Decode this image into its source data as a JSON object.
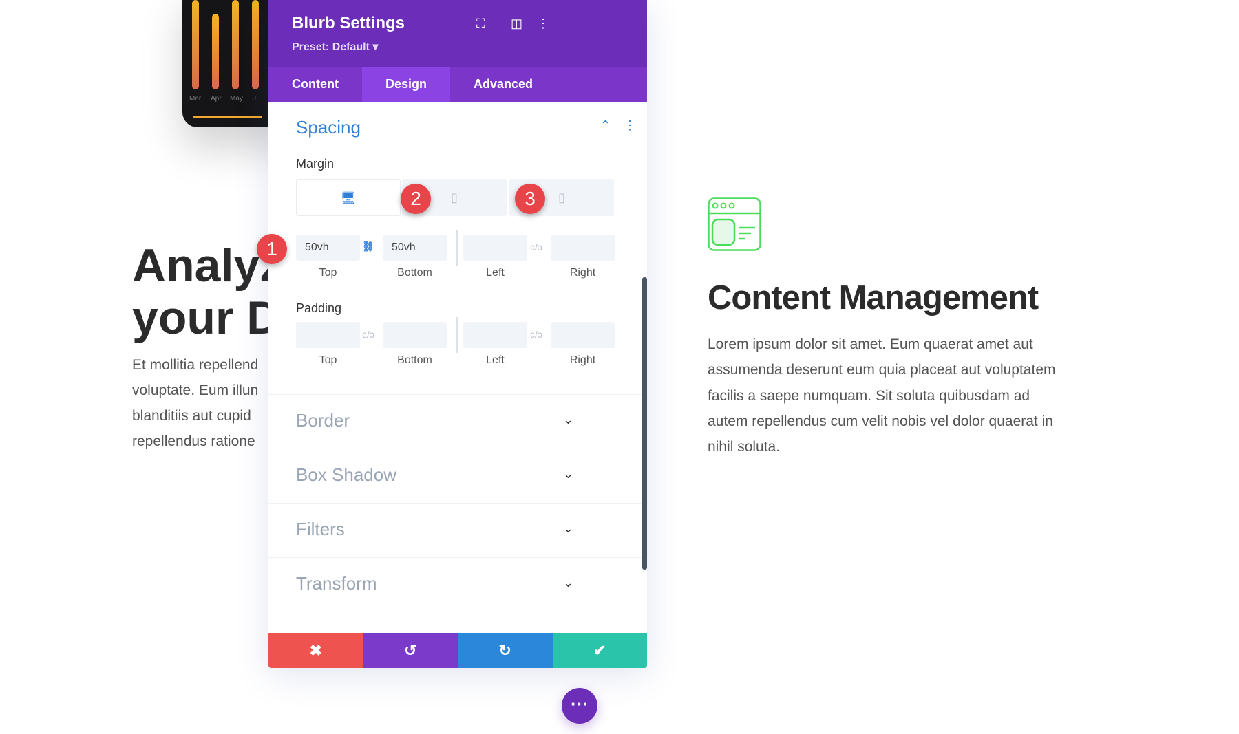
{
  "background": {
    "chart_months": [
      "Mar",
      "Apr",
      "May",
      "J"
    ],
    "left_heading": [
      "Analyz",
      "your D"
    ],
    "left_text": [
      "Et mollitia repellend",
      "voluptate. Eum illun",
      "blanditiis aut cupid",
      "repellendus ratione"
    ],
    "blurb": {
      "icon": "browser-window-icon",
      "icon_color": "#4cdc5c",
      "title": "Content Management",
      "text": "Lorem ipsum dolor sit amet. Eum quaerat amet aut assumenda deserunt eum quia placeat aut voluptatem facilis a saepe numquam. Sit soluta quibusdam ad autem repellendus cum velit nobis vel dolor quaerat in nihil soluta."
    }
  },
  "panel": {
    "title": "Blurb Settings",
    "preset": "Preset: Default ▾",
    "tabs": [
      {
        "label": "Content"
      },
      {
        "label": "Design"
      },
      {
        "label": "Advanced"
      }
    ],
    "active_tab": "Design",
    "spacing": {
      "title": "Spacing",
      "margin_label": "Margin",
      "padding_label": "Padding",
      "margin": {
        "top": "50vh",
        "bottom": "50vh",
        "left": "",
        "right": ""
      },
      "captions": {
        "top": "Top",
        "bottom": "Bottom",
        "left": "Left",
        "right": "Right"
      }
    },
    "sections": [
      "Border",
      "Box Shadow",
      "Filters",
      "Transform"
    ],
    "colors": {
      "header": "#6c2eb9",
      "cancel": "#ef5350",
      "undo": "#7b3ac9",
      "redo": "#2b87da",
      "save": "#29c4a9"
    }
  },
  "badges": [
    "1",
    "2",
    "3"
  ]
}
